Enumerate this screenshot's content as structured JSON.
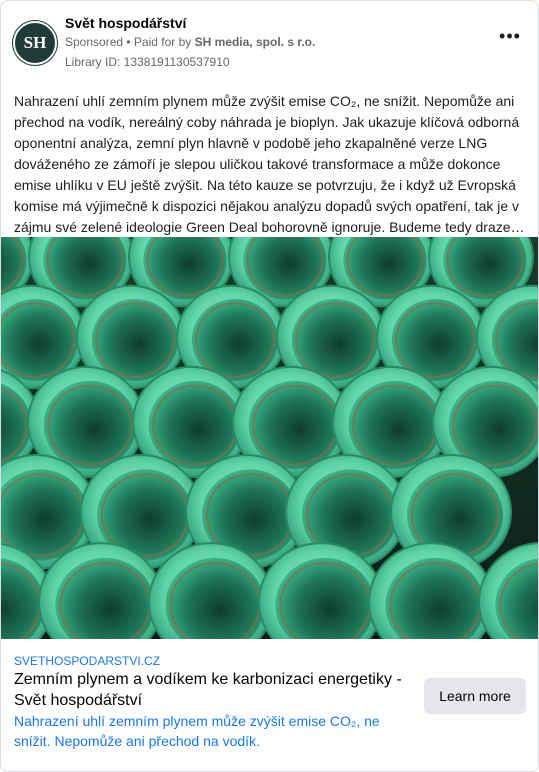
{
  "header": {
    "page_name": "Svět hospodářství",
    "avatar_initials": "SH",
    "sponsored_label": "Sponsored",
    "bullet": " • ",
    "paid_for_label": "Paid for by ",
    "payer": "SH media, spol. s r.o.",
    "library_id": "Library ID: 1338191130537910",
    "more_icon": "more-horizontal-icon",
    "more_label": "•••"
  },
  "post": {
    "text": "Nahrazení uhlí zemním plynem může zvýšit emise CO₂, ne snížit. Nepomůže ani přechod na vodík, nereálný coby náhrada je bioplyn. Jak ukazuje klíčová odborná oponentní analýza, zemní plyn hlavně v podobě jeho zkapalněné verze LNG dováženého ze zámoří je slepou uličkou takové transformace a může dokonce emise uhlíku v EU ještě zvýšit. Na této kauze se potvrzuju, že i když už Evropská komise má výjimečně k dispozici nějakou analýzu dopadů svých opatření, tak je v zájmu své zelené ideologie Green Deal bohorovně ignoruje. Budeme tedy draze…"
  },
  "link": {
    "domain": "SVETHOSPODARSTVI.CZ",
    "title": "Zemním plynem a vodíkem ke karbonizaci energetiky - Svět hospodářství",
    "description": "Nahrazení uhlí zemním plynem může zvýšit emise CO₂, ne snížit. Nepomůže ani přechod na vodík.",
    "cta_label": "Learn more"
  },
  "colors": {
    "link_blue": "#1877f2",
    "avatar_bg": "#1f3b38",
    "pipe_green": "#6fe0b8",
    "pipe_dark": "#1c7a58"
  }
}
